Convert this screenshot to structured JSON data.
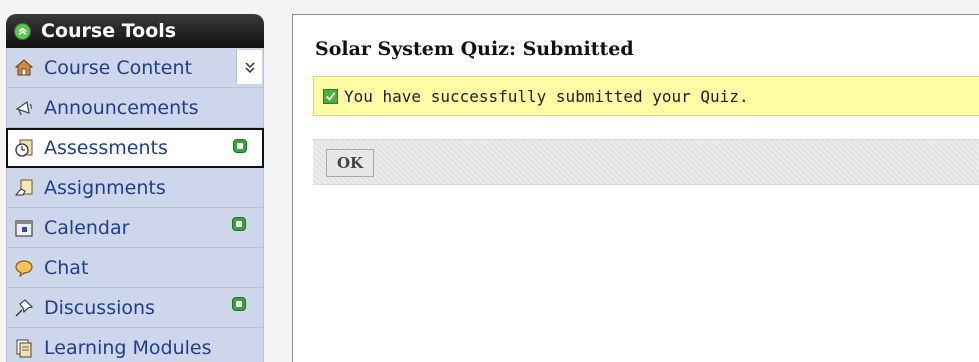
{
  "sidebar": {
    "title": "Course Tools",
    "items": [
      {
        "label": "Course Content",
        "icon": "home-icon"
      },
      {
        "label": "Announcements",
        "icon": "megaphone-icon"
      },
      {
        "label": "Assessments",
        "icon": "clock-quiz-icon",
        "selected": true,
        "has_new": true
      },
      {
        "label": "Assignments",
        "icon": "assignment-hand-icon"
      },
      {
        "label": "Calendar",
        "icon": "calendar-icon",
        "has_new": true
      },
      {
        "label": "Chat",
        "icon": "speech-bubble-icon"
      },
      {
        "label": "Discussions",
        "icon": "pushpin-icon",
        "has_new": true
      },
      {
        "label": "Learning Modules",
        "icon": "module-pages-icon"
      }
    ]
  },
  "main": {
    "title": "Solar System Quiz: Submitted",
    "success_message": "You have successfully submitted your Quiz.",
    "ok_label": "OK"
  },
  "colors": {
    "sidebar_bg": "#cdd6ea",
    "link_blue": "#1f3f8e",
    "banner_yellow": "#fefca4",
    "new_badge_green": "#3aa33a"
  }
}
